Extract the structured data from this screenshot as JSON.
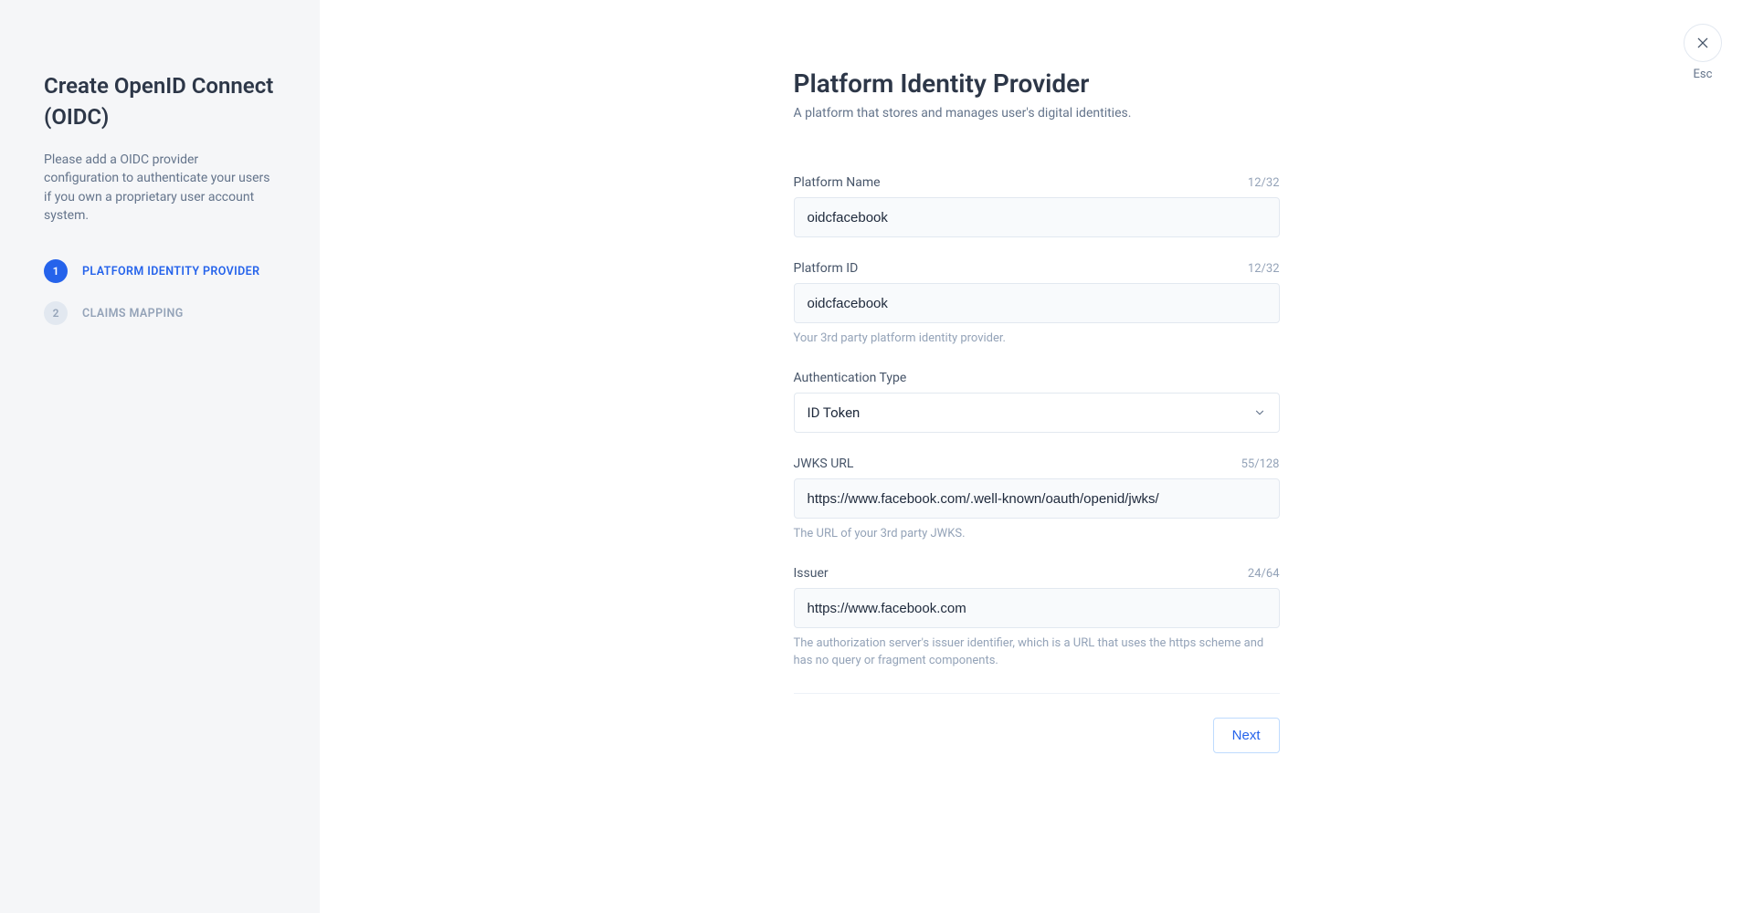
{
  "sidebar": {
    "title": "Create OpenID Connect (OIDC)",
    "description": "Please add a OIDC provider configuration to authenticate your users if you own a proprietary user account system.",
    "steps": [
      {
        "num": "1",
        "label": "PLATFORM IDENTITY PROVIDER",
        "active": true
      },
      {
        "num": "2",
        "label": "CLAIMS MAPPING",
        "active": false
      }
    ]
  },
  "close": {
    "esc": "Esc"
  },
  "page": {
    "title": "Platform Identity Provider",
    "subtitle": "A platform that stores and manages user's digital identities."
  },
  "fields": {
    "platform_name": {
      "label": "Platform Name",
      "count": "12/32",
      "value": "oidcfacebook"
    },
    "platform_id": {
      "label": "Platform ID",
      "count": "12/32",
      "value": "oidcfacebook",
      "help": "Your 3rd party platform identity provider."
    },
    "auth_type": {
      "label": "Authentication Type",
      "value": "ID Token"
    },
    "jwks_url": {
      "label": "JWKS URL",
      "count": "55/128",
      "value": "https://www.facebook.com/.well-known/oauth/openid/jwks/",
      "help": "The URL of your 3rd party JWKS."
    },
    "issuer": {
      "label": "Issuer",
      "count": "24/64",
      "value": "https://www.facebook.com",
      "help": "The authorization server's issuer identifier, which is a URL that uses the https scheme and has no query or fragment components."
    }
  },
  "footer": {
    "next": "Next"
  }
}
